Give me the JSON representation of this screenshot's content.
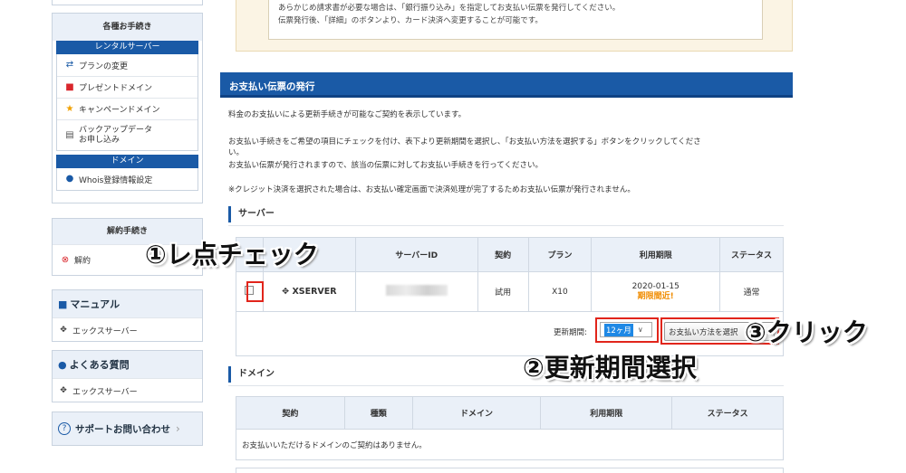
{
  "sidebar": {
    "procedures_title": "各種お手続き",
    "rental_server_header": "レンタルサーバー",
    "rental_items": [
      {
        "label": "プランの変更",
        "icon": "swap-arrows-icon"
      },
      {
        "label": "プレゼントドメイン",
        "icon": "gift-icon"
      },
      {
        "label": "キャンペーンドメイン",
        "icon": "star-icon"
      },
      {
        "label": "バックアップデータ",
        "label2": "お申し込み",
        "icon": "backup-drive-icon"
      }
    ],
    "domain_header": "ドメイン",
    "domain_items": [
      {
        "label": "Whois登録情報設定",
        "icon": "user-icon"
      }
    ],
    "cancel_title": "解約手続き",
    "cancel_item": {
      "label": "解約",
      "icon": "cancel-circle-icon"
    },
    "manual_title": "マニュアル",
    "manual_item": "エックスサーバー",
    "faq_title": "よくある質問",
    "faq_item": "エックスサーバー",
    "support_label": "サポートお問い合わせ",
    "support_chevron": "›"
  },
  "notice": {
    "line1": "あらかじめ請求書が必要な場合は、「銀行振り込み」を指定してお支払い伝票を発行してください。",
    "line2": "伝票発行後、「詳細」のボタンより、カード決済へ変更することが可能です。"
  },
  "section": {
    "title": "お支払い伝票の発行",
    "para1": "料金のお支払いによる更新手続きが可能なご契約を表示しています。",
    "para2a": "お支払い手続きをご希望の項目にチェックを付け、表下より更新期間を選択し、「お支払い方法を選択する」ボタンをクリックしてくださ",
    "para2b": "い。",
    "para3": "お支払い伝票が発行されますので、該当の伝票に対してお支払い手続きを行ってください。",
    "para4": "※クレジット決済を選択された場合は、お支払い確定画面で決済処理が完了するためお支払い伝票が発行されません。"
  },
  "server": {
    "heading": "サーバー",
    "columns": [
      "",
      "",
      "サーバーID",
      "契約",
      "プラン",
      "利用期限",
      "ステータス"
    ],
    "row": {
      "brand": "XSERVER",
      "contract": "試用",
      "plan": "X10",
      "expiry_date": "2020-01-15",
      "expiry_note": "期限間近!",
      "status": "通常"
    },
    "renew_label": "更新期間:",
    "renew_value": "12ヶ月",
    "pay_button": "お支払い方法を選択"
  },
  "domain": {
    "heading": "ドメイン",
    "columns": [
      "契約",
      "種類",
      "ドメイン",
      "利用期限",
      "ステータス"
    ],
    "empty_message": "お支払いいただけるドメインのご契約はありません。"
  },
  "annotations": {
    "step1": "①レ点チェック",
    "step2": "②更新期間選択",
    "step3": "③クリック"
  },
  "colors": {
    "brand_blue": "#1a5aa6",
    "highlight_red": "#e1251b",
    "warning_orange": "#f08c00"
  }
}
